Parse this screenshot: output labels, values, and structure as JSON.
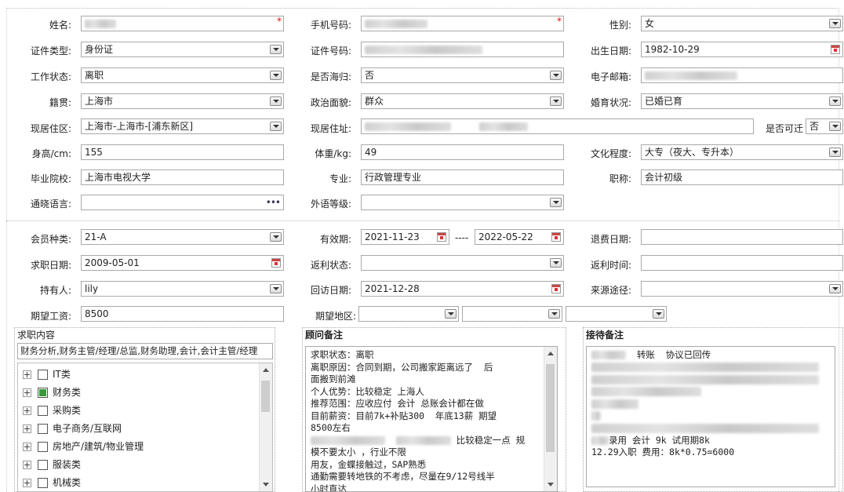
{
  "form": {
    "name_label": "姓名:",
    "phone_label": "手机号码:",
    "gender_label": "性别:",
    "gender_value": "女",
    "idtype_label": "证件类型:",
    "idtype_value": "身份证",
    "idnum_label": "证件号码:",
    "birth_label": "出生日期:",
    "birth_value": "1982-10-29",
    "workstatus_label": "工作状态:",
    "workstatus_value": "离职",
    "overseas_label": "是否海归:",
    "overseas_value": "否",
    "email_label": "电子邮箱:",
    "native_label": "籍贯:",
    "native_value": "上海市",
    "political_label": "政治面貌:",
    "political_value": "群众",
    "marital_label": "婚育状况:",
    "marital_value": "已婚已育",
    "residence_label": "现居住区:",
    "residence_value": "上海市-上海市-[浦东新区]",
    "address_label": "现居住址:",
    "relocate_label": "是否可迁",
    "relocate_value": "否",
    "height_label": "身高/cm:",
    "height_value": "155",
    "weight_label": "体重/kg:",
    "weight_value": "49",
    "education_label": "文化程度:",
    "education_value": "大专（夜大、专升本）",
    "school_label": "毕业院校:",
    "school_value": "上海市电视大学",
    "major_label": "专业:",
    "major_value": "行政管理专业",
    "title_label": "职称:",
    "title_value": "会计初级",
    "language_label": "通晓语言:",
    "language_more": "•••",
    "langlevel_label": "外语等级:",
    "member_label": "会员种类:",
    "member_value": "21-A",
    "validity_label": "有效期:",
    "validity_from": "2021-11-23",
    "validity_sep": "----",
    "validity_to": "2022-05-22",
    "refund_label": "退费日期:",
    "jobdate_label": "求职日期:",
    "jobdate_value": "2009-05-01",
    "rebate_status_label": "返利状态:",
    "rebate_time_label": "返利时间:",
    "holder_label": "持有人:",
    "holder_value": "lily",
    "visit_label": "回访日期:",
    "visit_value": "2021-12-28",
    "source_label": "来源途径:",
    "salary_label": "期望工资:",
    "salary_value": "8500",
    "region_label": "期望地区:"
  },
  "job_content": {
    "title": "求职内容",
    "selected": "财务分析,财务主管/经理/总监,财务助理,会计,会计主管/经理",
    "tree": [
      {
        "label": "IT类",
        "checked": false
      },
      {
        "label": "财务类",
        "checked": true
      },
      {
        "label": "采购类",
        "checked": false
      },
      {
        "label": "电子商务/互联网",
        "checked": false
      },
      {
        "label": "房地产/建筑/物业管理",
        "checked": false
      },
      {
        "label": "服装类",
        "checked": false
      },
      {
        "label": "机械类",
        "checked": false
      }
    ]
  },
  "advisor_notes": {
    "title": "顾问备注",
    "lines": [
      "求职状态：离职",
      "离职原因：合同到期，公司搬家距离远了  后",
      "面搬到前滩",
      "个人优势：比较稳定 上海人",
      "推荐范围：应收应付 会计 总账会计都在做",
      "目前薪资：目前7k+补贴300  年底13薪 期望",
      "8500左右",
      "比较稳定一点 规",
      "模不要太小 ，行业不限",
      "用友，金蝶接触过，SAP熟悉",
      "通勤需要转地铁的不考虑，尽量在9/12号线半",
      "小时直达"
    ]
  },
  "reception_notes": {
    "title": "接待备注",
    "line1": "转账  协议已回传",
    "line2": "录用 会计 9k 试用期8k",
    "line3": "12.29入职 费用：8k*0.75=6000"
  },
  "icons": {
    "dropdown": "chevron-down-icon",
    "calendar": "calendar-icon",
    "required": "required-star-icon",
    "tree_expand": "plus-icon",
    "checkbox": "checkbox-icon"
  },
  "colors": {
    "required": "#ee0000",
    "checked": "#3a9a3a",
    "calendar": "#cc4444"
  }
}
